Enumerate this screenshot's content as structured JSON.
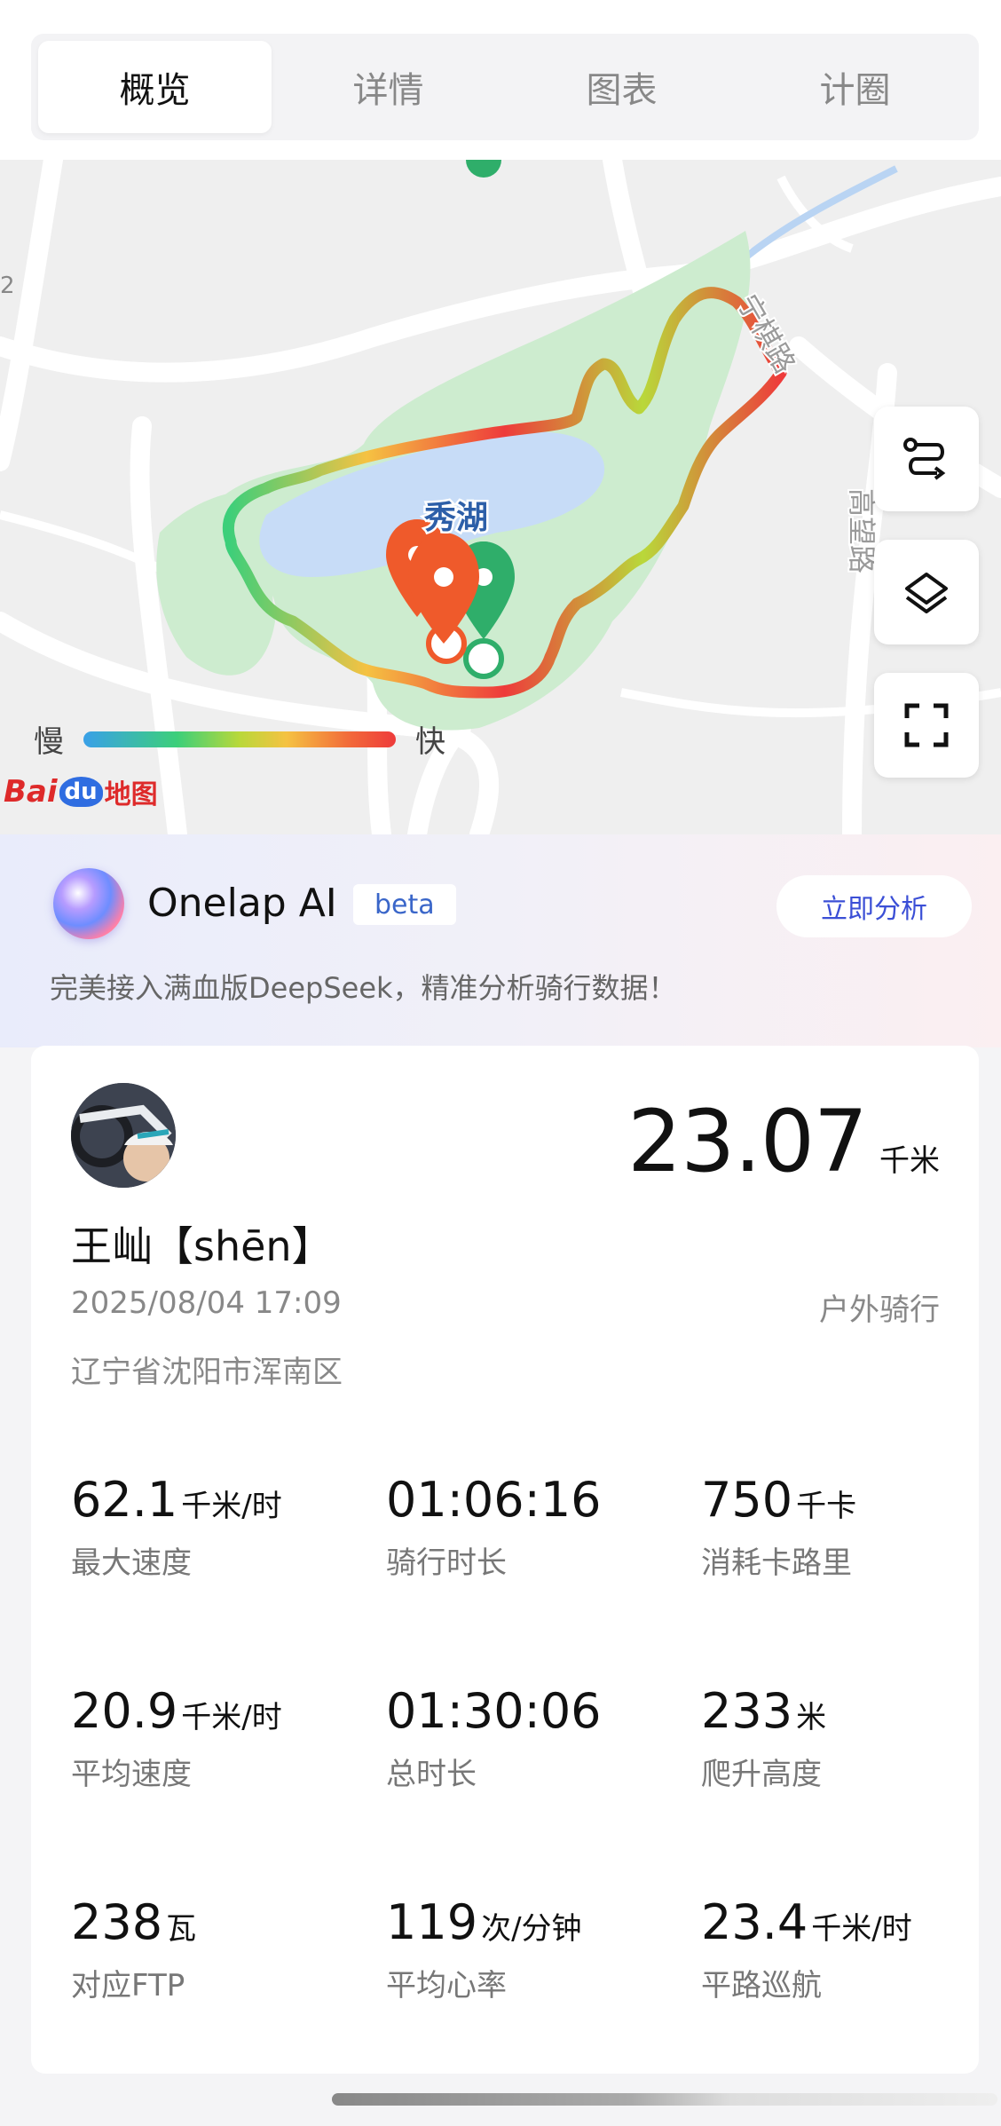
{
  "tabs": [
    {
      "label": "概览",
      "active": true
    },
    {
      "label": "详情",
      "active": false
    },
    {
      "label": "图表",
      "active": false
    },
    {
      "label": "计圈",
      "active": false
    }
  ],
  "map": {
    "lake_label": "秀湖",
    "road_label_1": "宁棋路",
    "road_label_2": "高望路",
    "edge_label": "2",
    "legend_slow": "慢",
    "legend_fast": "快",
    "watermark_text": "Baidu地图",
    "buttons": [
      "route-icon",
      "layers-icon",
      "fullscreen-icon"
    ]
  },
  "ai_banner": {
    "title": "Onelap AI",
    "badge": "beta",
    "button": "立即分析",
    "subtitle": "完美接入满血版DeepSeek，精准分析骑行数据！"
  },
  "ride": {
    "distance": "23.07",
    "distance_unit": "千米",
    "user_name": "王屾【shēn】",
    "datetime": "2025/08/04 17:09",
    "type": "户外骑行",
    "location": "辽宁省沈阳市浑南区"
  },
  "stats": [
    {
      "value": "62.1",
      "unit": "千米/时",
      "label": "最大速度"
    },
    {
      "value": "01:06:16",
      "unit": "",
      "label": "骑行时长"
    },
    {
      "value": "750",
      "unit": "千卡",
      "label": "消耗卡路里"
    },
    {
      "value": "20.9",
      "unit": "千米/时",
      "label": "平均速度"
    },
    {
      "value": "01:30:06",
      "unit": "",
      "label": "总时长"
    },
    {
      "value": "233",
      "unit": "米",
      "label": "爬升高度"
    },
    {
      "value": "238",
      "unit": "瓦",
      "label": "对应FTP"
    },
    {
      "value": "119",
      "unit": "次/分钟",
      "label": "平均心率"
    },
    {
      "value": "23.4",
      "unit": "千米/时",
      "label": "平路巡航"
    }
  ],
  "colors": {
    "accent": "#3b4fd6",
    "park_green": "#cdeccf",
    "lake_blue": "#c7dcf7",
    "start_pin": "#ef5a2b",
    "end_pin": "#2fae6a"
  }
}
